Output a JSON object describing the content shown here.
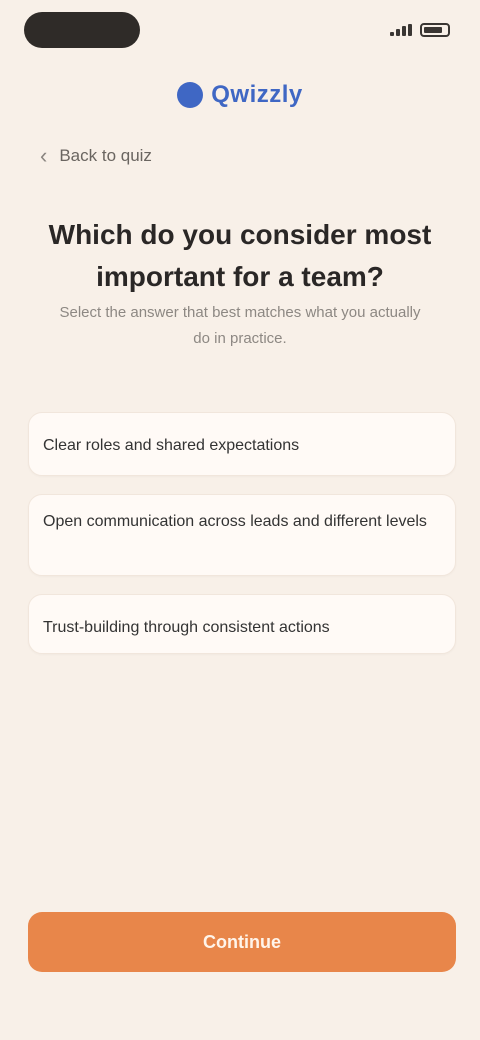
{
  "header": {
    "logo_text": "Qwizzly",
    "back_label": "Back to quiz"
  },
  "question": {
    "title": "Which do you consider most important for a team?",
    "subtitle": "Select the answer that best matches what you actually do in practice."
  },
  "options": [
    {
      "label": "Clear roles and shared expectations"
    },
    {
      "label": "Open communication across leads and different levels"
    },
    {
      "label": "Trust-building through consistent actions"
    }
  ],
  "cta": {
    "label": "Continue"
  },
  "colors": {
    "background": "#f8f0e8",
    "accent": "#e8864a",
    "brand": "#3f67c4"
  }
}
